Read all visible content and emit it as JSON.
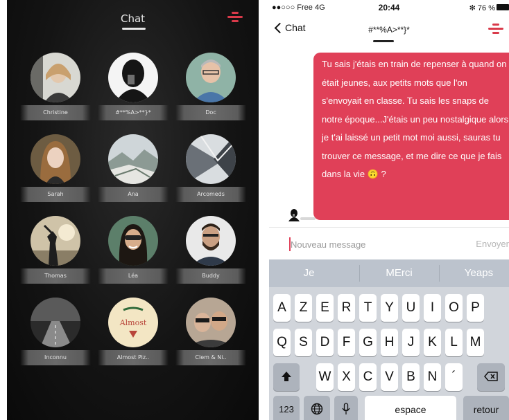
{
  "left_screen": {
    "title": "Chat",
    "contacts": [
      {
        "name": "Christine",
        "avatar": "woman-with-hat-photo"
      },
      {
        "name": "#**%A>**}*",
        "avatar": "silhouette-selfie-photo"
      },
      {
        "name": "Doc",
        "avatar": "man-with-glasses-photo"
      },
      {
        "name": "Sarah",
        "avatar": "woman-portrait-photo"
      },
      {
        "name": "Ana",
        "avatar": "snowy-landscape-photo"
      },
      {
        "name": "Arcomeds",
        "avatar": "building-architecture-photo"
      },
      {
        "name": "Thomas",
        "avatar": "beach-sunset-silhouette-photo"
      },
      {
        "name": "Léa",
        "avatar": "woman-with-sunglasses-photo"
      },
      {
        "name": "Buddy",
        "avatar": "bearded-man-photo"
      },
      {
        "name": "Inconnu",
        "avatar": "dark-road-photo"
      },
      {
        "name": "Almost Piz..",
        "avatar": "pizza-logo",
        "logo_text": "Almost"
      },
      {
        "name": "Clem & Ni..",
        "avatar": "couple-selfie-photo"
      }
    ]
  },
  "right_screen": {
    "status_bar": {
      "carrier": "●●○○○ Free  4G",
      "time": "20:44",
      "battery": "✻ 76 %"
    },
    "nav": {
      "back_label": "Chat",
      "conversation_title": "#**%A>**}*"
    },
    "message": {
      "text": "Tu sais j'étais en train de repenser à quand on était jeunes, aux petits mots que l'on s'envoyait en classe. Tu sais les snaps de notre époque...J'étais un peu nostalgique alors je t'ai laissé un petit mot moi aussi, sauras tu trouver ce message, et me dire ce que je fais dans la vie 🙃 ?"
    },
    "input": {
      "placeholder": "Nouveau message",
      "value": "",
      "send_label": "Envoyer"
    },
    "keyboard": {
      "suggestions": [
        "Je",
        "MErci",
        "Yeaps"
      ],
      "row1": [
        "A",
        "Z",
        "E",
        "R",
        "T",
        "Y",
        "U",
        "I",
        "O",
        "P"
      ],
      "row2": [
        "Q",
        "S",
        "D",
        "F",
        "G",
        "H",
        "J",
        "K",
        "L",
        "M"
      ],
      "row3": [
        "W",
        "X",
        "C",
        "V",
        "B",
        "N",
        "´"
      ],
      "numbers_key": "123",
      "space_key": "espace",
      "return_key": "retour"
    }
  },
  "colors": {
    "accent_red": "#e04058",
    "dark_bg": "#141414"
  }
}
